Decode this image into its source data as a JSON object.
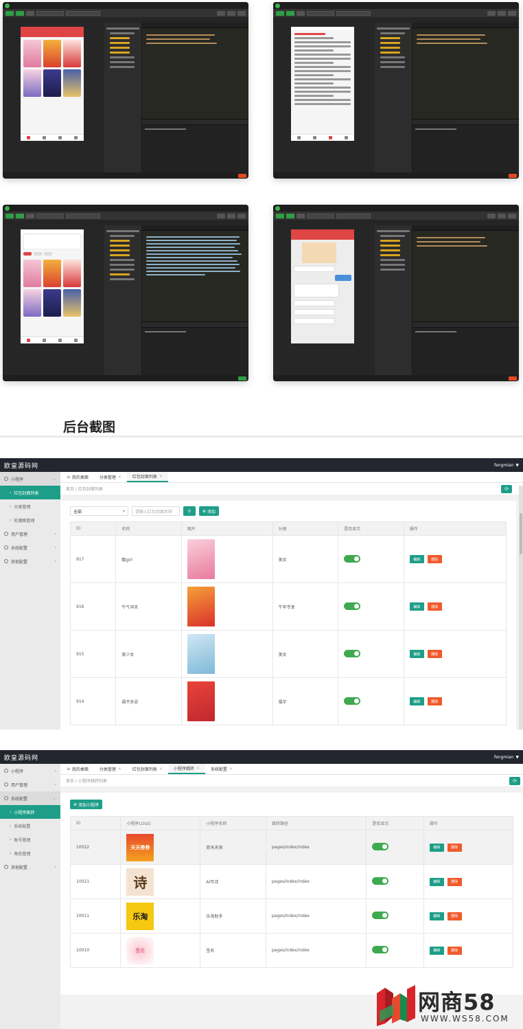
{
  "section_heading": "后台截图",
  "panel1": {
    "brand": "欧皇源码网",
    "user": "fengmian",
    "sidebar": [
      {
        "label": "小程序",
        "type": "parent-open"
      },
      {
        "label": "红包封面列表",
        "type": "active"
      },
      {
        "label": "分类管理",
        "type": "sub"
      },
      {
        "label": "轮播图管理",
        "type": "sub"
      },
      {
        "label": "用户管理",
        "type": "parent"
      },
      {
        "label": "系统配置",
        "type": "parent"
      },
      {
        "label": "其他配置",
        "type": "parent"
      }
    ],
    "tabs": [
      {
        "label": "我的桌面",
        "home": true
      },
      {
        "label": "分类管理"
      },
      {
        "label": "红包封面列表",
        "active": true
      }
    ],
    "breadcrumb": "首页 / 红包封面列表",
    "filter": {
      "select_value": "全部",
      "search_placeholder": "请输入红包封面名称",
      "add_label": "添加"
    },
    "columns": [
      "ID",
      "名称",
      "图片",
      "分类",
      "是否显示",
      "操作"
    ],
    "rows": [
      {
        "id": "917",
        "name": "靓girl",
        "category": "美女",
        "shown": true
      },
      {
        "id": "916",
        "name": "牛气冲天",
        "category": "牛年专享",
        "shown": true
      },
      {
        "id": "915",
        "name": "美少女",
        "category": "美女",
        "shown": true
      },
      {
        "id": "914",
        "name": "福不多说",
        "category": "福字",
        "shown": true
      }
    ],
    "edit_label": "编辑",
    "delete_label": "删除"
  },
  "panel2": {
    "brand": "欧皇源码网",
    "user": "fengmian",
    "sidebar": [
      {
        "label": "小程序",
        "type": "parent"
      },
      {
        "label": "用户管理",
        "type": "parent"
      },
      {
        "label": "系统配置",
        "type": "parent-open"
      },
      {
        "label": "小程序跳转",
        "type": "active"
      },
      {
        "label": "系统配置",
        "type": "sub"
      },
      {
        "label": "账号管理",
        "type": "sub"
      },
      {
        "label": "角色管理",
        "type": "sub"
      },
      {
        "label": "其他配置",
        "type": "parent"
      }
    ],
    "tabs": [
      {
        "label": "我的桌面",
        "home": true
      },
      {
        "label": "分类管理"
      },
      {
        "label": "红包封面列表"
      },
      {
        "label": "小程序跳转",
        "active": true
      },
      {
        "label": "系统配置"
      }
    ],
    "breadcrumb": "首页 / 小程序跳转列表",
    "add_label": "添加小程序",
    "columns": [
      "ID",
      "小程序LOGO",
      "小程序名称",
      "跳转路径",
      "是否显示",
      "操作"
    ],
    "rows": [
      {
        "id": "10022",
        "logo": "天天券券",
        "name": "券天天领",
        "path": "pages/index/index",
        "shown": true
      },
      {
        "id": "10021",
        "logo": "诗",
        "name": "AI写诗",
        "path": "pages/index/index",
        "shown": true
      },
      {
        "id": "10011",
        "logo": "乐淘",
        "name": "乐淘助手",
        "path": "pages/index/index",
        "shown": true
      },
      {
        "id": "10010",
        "logo": "签名",
        "name": "签名",
        "path": "pages/index/index",
        "shown": true
      }
    ],
    "edit_label": "编辑",
    "delete_label": "删除"
  },
  "watermark": {
    "name": "网商58",
    "url": "WWW.WS58.COM"
  },
  "colors": {
    "accent": "#1e9e88",
    "danger": "#f05a2c",
    "switch_on": "#3ea94f",
    "topbar": "#23262e"
  }
}
